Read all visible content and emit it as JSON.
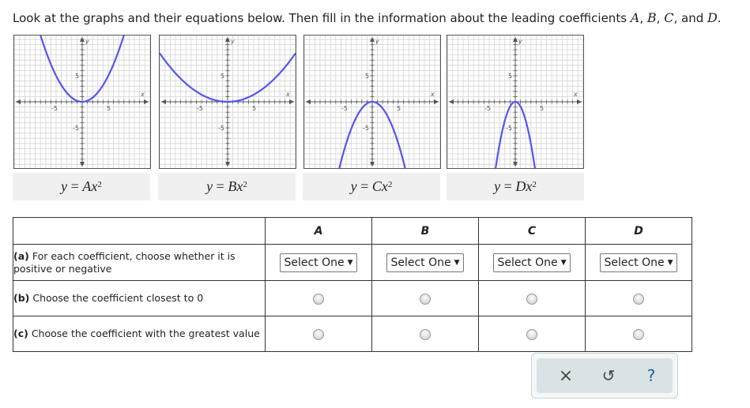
{
  "instructions": {
    "prefix": "Look at the graphs and their equations below. Then fill in the information about the leading coefficients",
    "letters": [
      "A",
      "B",
      "C",
      "D"
    ]
  },
  "graphs": [
    {
      "id": "A",
      "equation": {
        "lhs": "y",
        "op": "=",
        "coef": "A",
        "var": "x",
        "exp": "2"
      }
    },
    {
      "id": "B",
      "equation": {
        "lhs": "y",
        "op": "=",
        "coef": "B",
        "var": "x",
        "exp": "2"
      }
    },
    {
      "id": "C",
      "equation": {
        "lhs": "y",
        "op": "=",
        "coef": "C",
        "var": "x",
        "exp": "2"
      }
    },
    {
      "id": "D",
      "equation": {
        "lhs": "y",
        "op": "=",
        "coef": "D",
        "var": "x",
        "exp": "2"
      }
    }
  ],
  "axis_labels": {
    "x": "x",
    "y": "y",
    "pos": "5",
    "neg": "-5"
  },
  "table": {
    "columns": [
      "A",
      "B",
      "C",
      "D"
    ],
    "rows": [
      {
        "bold": "(a)",
        "text": " For each coefficient, choose whether it is positive or negative",
        "control": "select",
        "select_label": "Select One"
      },
      {
        "bold": "(b)",
        "text": " Choose the coefficient closest to 0",
        "control": "radio"
      },
      {
        "bold": "(c)",
        "text": " Choose the coefficient with the greatest value",
        "control": "radio"
      }
    ]
  },
  "toolbar": {
    "clear": "×",
    "undo": "↺",
    "help": "?"
  },
  "colors": {
    "curve": "#5555ee",
    "grid": "#d4d4d4",
    "axis": "#555555"
  }
}
